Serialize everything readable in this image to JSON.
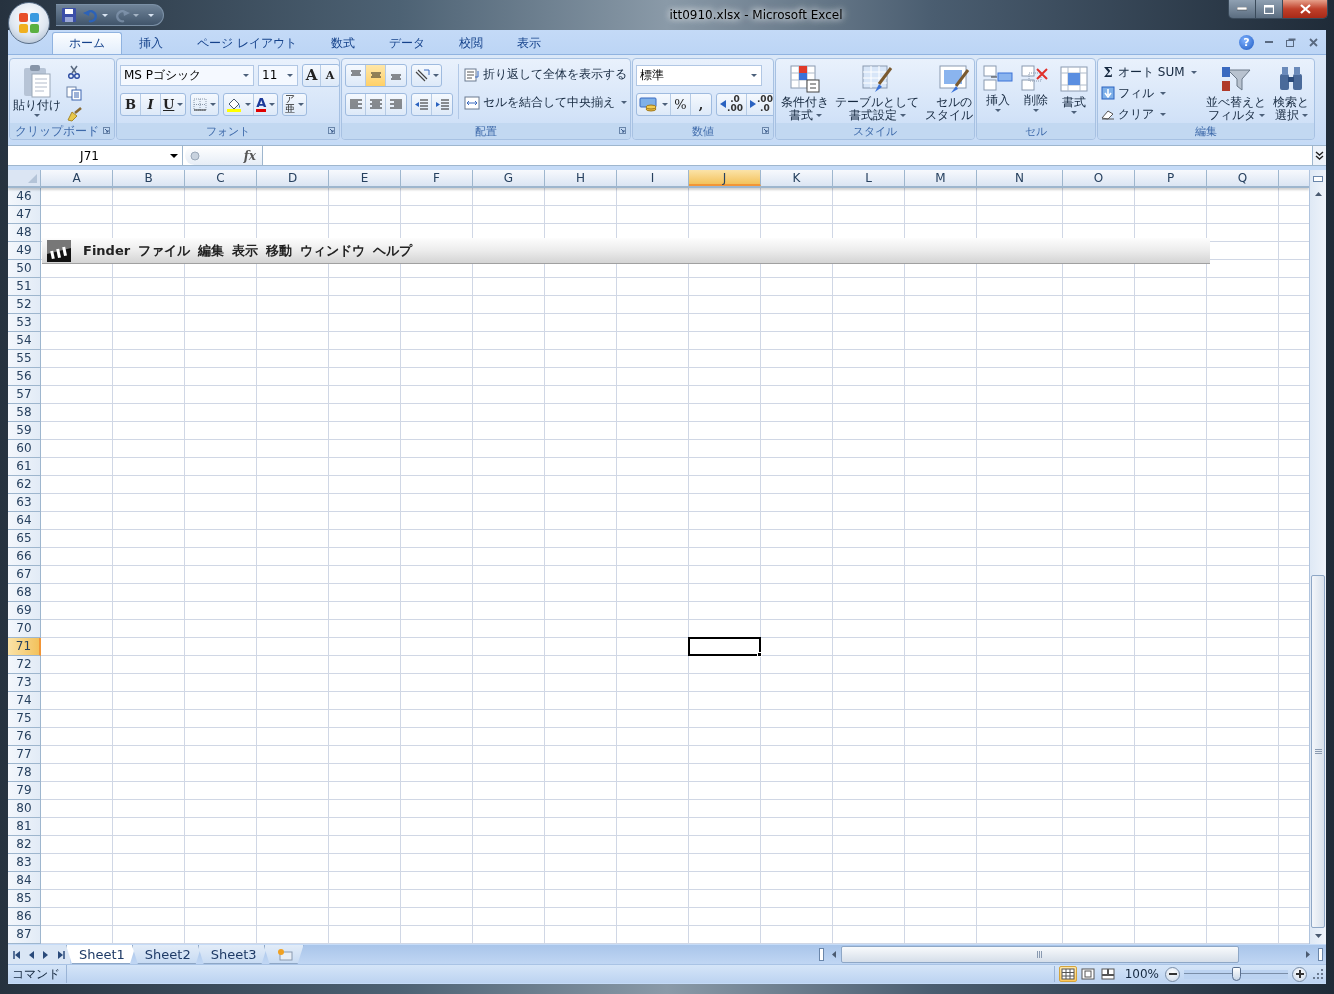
{
  "window": {
    "title": "itt0910.xlsx - Microsoft Excel"
  },
  "quick_access": [
    {
      "kind": "save",
      "disabled": false
    },
    {
      "kind": "undo",
      "disabled": false
    },
    {
      "kind": "redo",
      "disabled": true
    }
  ],
  "ribbon_tabs": [
    {
      "label": "ホーム",
      "selected": true
    },
    {
      "label": "挿入",
      "selected": false
    },
    {
      "label": "ページ レイアウト",
      "selected": false
    },
    {
      "label": "数式",
      "selected": false
    },
    {
      "label": "データ",
      "selected": false
    },
    {
      "label": "校閲",
      "selected": false
    },
    {
      "label": "表示",
      "selected": false
    }
  ],
  "help": "?",
  "groups": [
    {
      "kind": "clipboard",
      "label": "クリップボード",
      "paste": "貼り付け"
    },
    {
      "kind": "font",
      "label": "フォント",
      "font_name": "MS Pゴシック",
      "font_size": "11",
      "grow": "A",
      "shrink": "A",
      "bold": "B",
      "italic": "I",
      "underline": "U",
      "font_color": "A",
      "phonetic": "亜",
      "phonetic_ruby": "ア"
    },
    {
      "kind": "alignment",
      "label": "配置",
      "vertical_align": [
        {
          "selected": false
        },
        {
          "selected": true
        },
        {
          "selected": false
        }
      ],
      "horizontal_align": [
        {
          "selected": false
        },
        {
          "selected": false
        },
        {
          "selected": false
        }
      ],
      "wrap": "折り返して全体を表示する",
      "merge": "セルを結合して中央揃え"
    },
    {
      "kind": "number",
      "label": "数値",
      "format": "標準",
      "percent": "%",
      "comma": ",",
      "increase_decimal": [
        ".0",
        ".00"
      ],
      "decrease_decimal": [
        ".00",
        ".0"
      ]
    },
    {
      "kind": "styles",
      "label": "スタイル",
      "buttons": [
        [
          "条件付き",
          "書式"
        ],
        [
          "テーブルとして",
          "書式設定"
        ],
        [
          "セルの",
          "スタイル"
        ]
      ]
    },
    {
      "kind": "cells",
      "label": "セル",
      "buttons": [
        "挿入",
        "削除",
        "書式"
      ]
    },
    {
      "kind": "editing",
      "label": "編集",
      "sum_symbol": "Σ",
      "small": [
        "オート SUM",
        "フィル",
        "クリア"
      ],
      "large": [
        [
          "並べ替えと",
          "フィルタ"
        ],
        [
          "検索と",
          "選択"
        ]
      ]
    }
  ],
  "name_box": "J71",
  "function_label": "fx",
  "columns": [
    {
      "label": "A",
      "selected": false
    },
    {
      "label": "B",
      "selected": false
    },
    {
      "label": "C",
      "selected": false
    },
    {
      "label": "D",
      "selected": false
    },
    {
      "label": "E",
      "selected": false
    },
    {
      "label": "F",
      "selected": false
    },
    {
      "label": "G",
      "selected": false
    },
    {
      "label": "H",
      "selected": false
    },
    {
      "label": "I",
      "selected": false
    },
    {
      "label": "J",
      "selected": true
    },
    {
      "label": "K",
      "selected": false
    },
    {
      "label": "L",
      "selected": false
    },
    {
      "label": "M",
      "selected": false
    },
    {
      "label": "N",
      "selected": false
    },
    {
      "label": "O",
      "selected": false
    },
    {
      "label": "P",
      "selected": false
    },
    {
      "label": "Q",
      "selected": false
    }
  ],
  "rows": [
    {
      "label": "46",
      "selected": false
    },
    {
      "label": "47",
      "selected": false
    },
    {
      "label": "48",
      "selected": false
    },
    {
      "label": "49",
      "selected": false
    },
    {
      "label": "50",
      "selected": false
    },
    {
      "label": "51",
      "selected": false
    },
    {
      "label": "52",
      "selected": false
    },
    {
      "label": "53",
      "selected": false
    },
    {
      "label": "54",
      "selected": false
    },
    {
      "label": "55",
      "selected": false
    },
    {
      "label": "56",
      "selected": false
    },
    {
      "label": "57",
      "selected": false
    },
    {
      "label": "58",
      "selected": false
    },
    {
      "label": "59",
      "selected": false
    },
    {
      "label": "60",
      "selected": false
    },
    {
      "label": "61",
      "selected": false
    },
    {
      "label": "62",
      "selected": false
    },
    {
      "label": "63",
      "selected": false
    },
    {
      "label": "64",
      "selected": false
    },
    {
      "label": "65",
      "selected": false
    },
    {
      "label": "66",
      "selected": false
    },
    {
      "label": "67",
      "selected": false
    },
    {
      "label": "68",
      "selected": false
    },
    {
      "label": "69",
      "selected": false
    },
    {
      "label": "70",
      "selected": false
    },
    {
      "label": "71",
      "selected": true
    },
    {
      "label": "72",
      "selected": false
    },
    {
      "label": "73",
      "selected": false
    },
    {
      "label": "74",
      "selected": false
    },
    {
      "label": "75",
      "selected": false
    },
    {
      "label": "76",
      "selected": false
    },
    {
      "label": "77",
      "selected": false
    },
    {
      "label": "78",
      "selected": false
    },
    {
      "label": "79",
      "selected": false
    },
    {
      "label": "80",
      "selected": false
    },
    {
      "label": "81",
      "selected": false
    },
    {
      "label": "82",
      "selected": false
    },
    {
      "label": "83",
      "selected": false
    },
    {
      "label": "84",
      "selected": false
    },
    {
      "label": "85",
      "selected": false
    },
    {
      "label": "86",
      "selected": false
    },
    {
      "label": "87",
      "selected": false
    }
  ],
  "embedded_image": {
    "menu_items": [
      "Finder",
      "ファイル",
      "編集",
      "表示",
      "移動",
      "ウィンドウ",
      "ヘルプ"
    ]
  },
  "sheet_tabs": [
    {
      "label": "Sheet1",
      "selected": true
    },
    {
      "label": "Sheet2",
      "selected": false
    },
    {
      "label": "Sheet3",
      "selected": false
    }
  ],
  "status_bar": {
    "mode": "コマンド",
    "view_buttons": [
      {
        "selected": true
      },
      {
        "selected": false
      },
      {
        "selected": false
      }
    ],
    "zoom": "100%",
    "zoom_slider": {
      "level": 0.5
    }
  }
}
